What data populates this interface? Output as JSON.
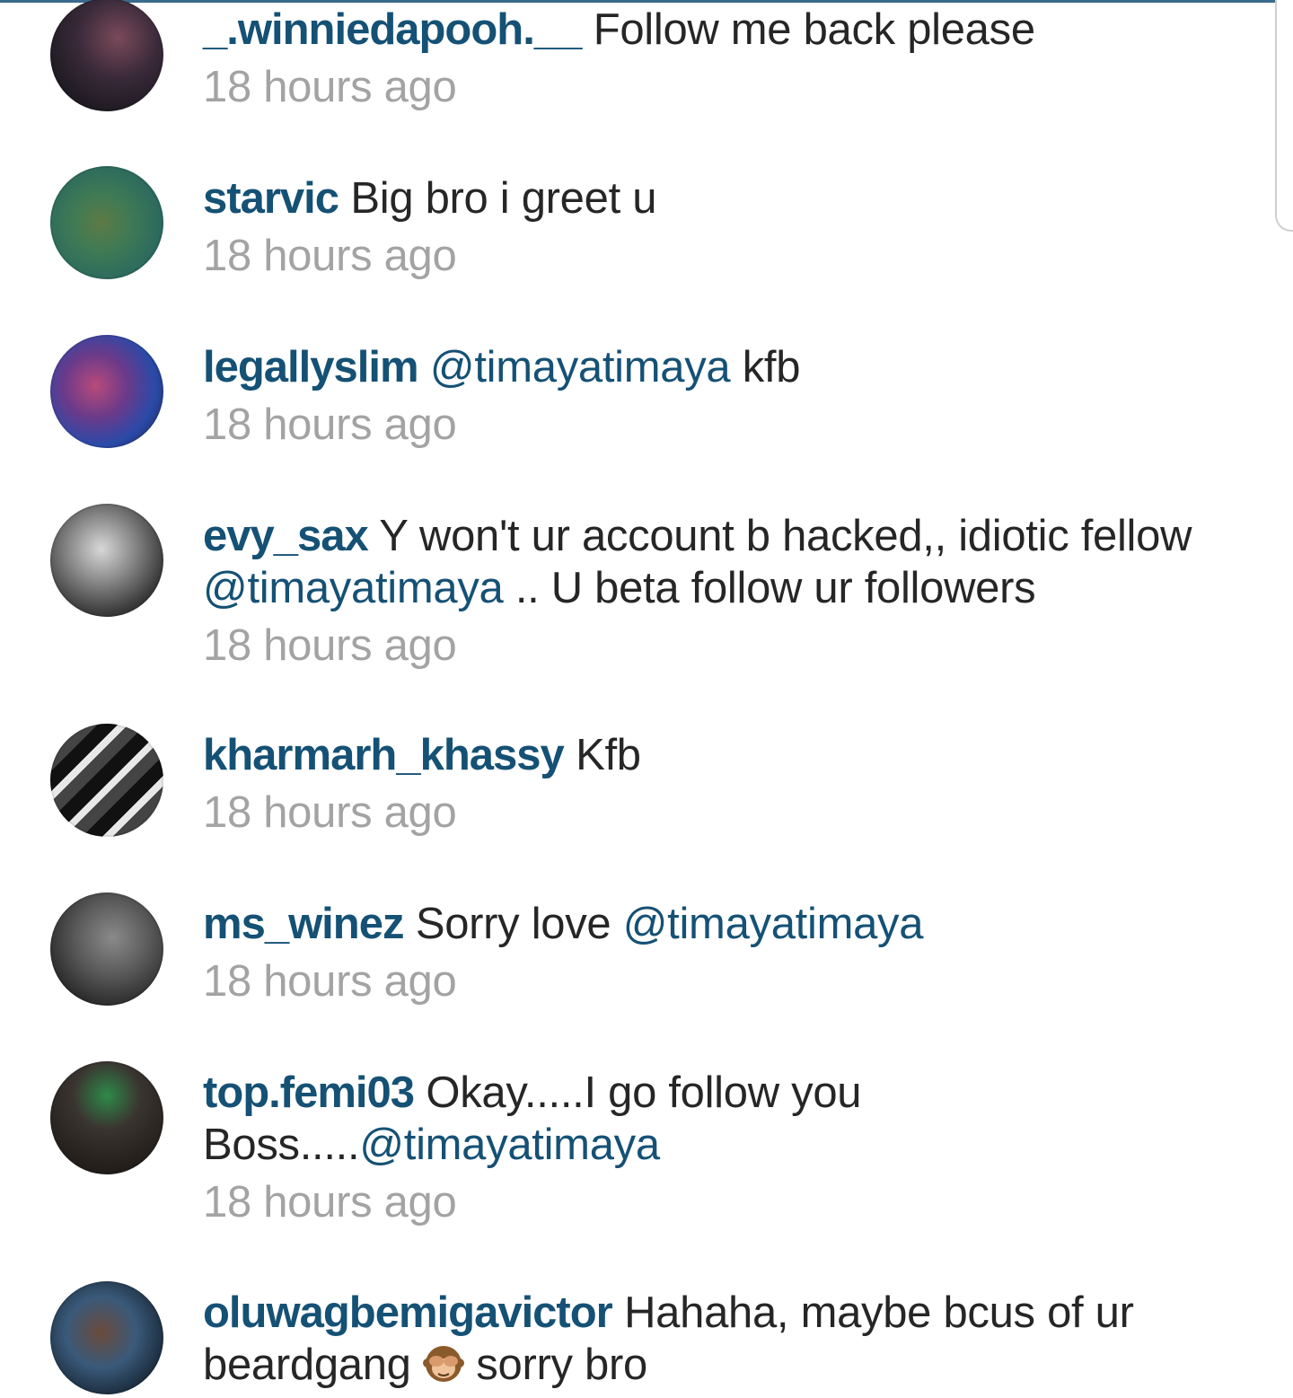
{
  "comments": [
    {
      "username": "_.winniedapooh.__",
      "before": "Follow me back please",
      "mention": "",
      "after": "",
      "time": "18 hours ago"
    },
    {
      "username": "starvic",
      "before": "Big bro i greet u",
      "mention": "",
      "after": "",
      "time": "18 hours ago"
    },
    {
      "username": "legallyslim",
      "before": "",
      "mention": "@timayatimaya",
      "after": "kfb",
      "time": "18 hours ago"
    },
    {
      "username": "evy_sax",
      "before": "Y won't ur account b hacked,, idiotic fellow",
      "mention": "@timayatimaya",
      "after": ".. U beta follow ur followers",
      "time": "18 hours ago"
    },
    {
      "username": "kharmarh_khassy",
      "before": "Kfb",
      "mention": "",
      "after": "",
      "time": "18 hours ago"
    },
    {
      "username": "ms_winez",
      "before": "Sorry love",
      "mention": "@timayatimaya",
      "after": "",
      "time": "18 hours ago"
    },
    {
      "username": "top.femi03",
      "before": "Okay.....I go follow you Boss.....",
      "mention": "@timayatimaya",
      "after": "",
      "time": "18 hours ago"
    },
    {
      "username": "oluwagbemigavictor",
      "before": "Hahaha, maybe bcus of ur beardgang",
      "emoji": "see-no-evil-monkey-icon",
      "after": "sorry bro",
      "time": ""
    }
  ]
}
